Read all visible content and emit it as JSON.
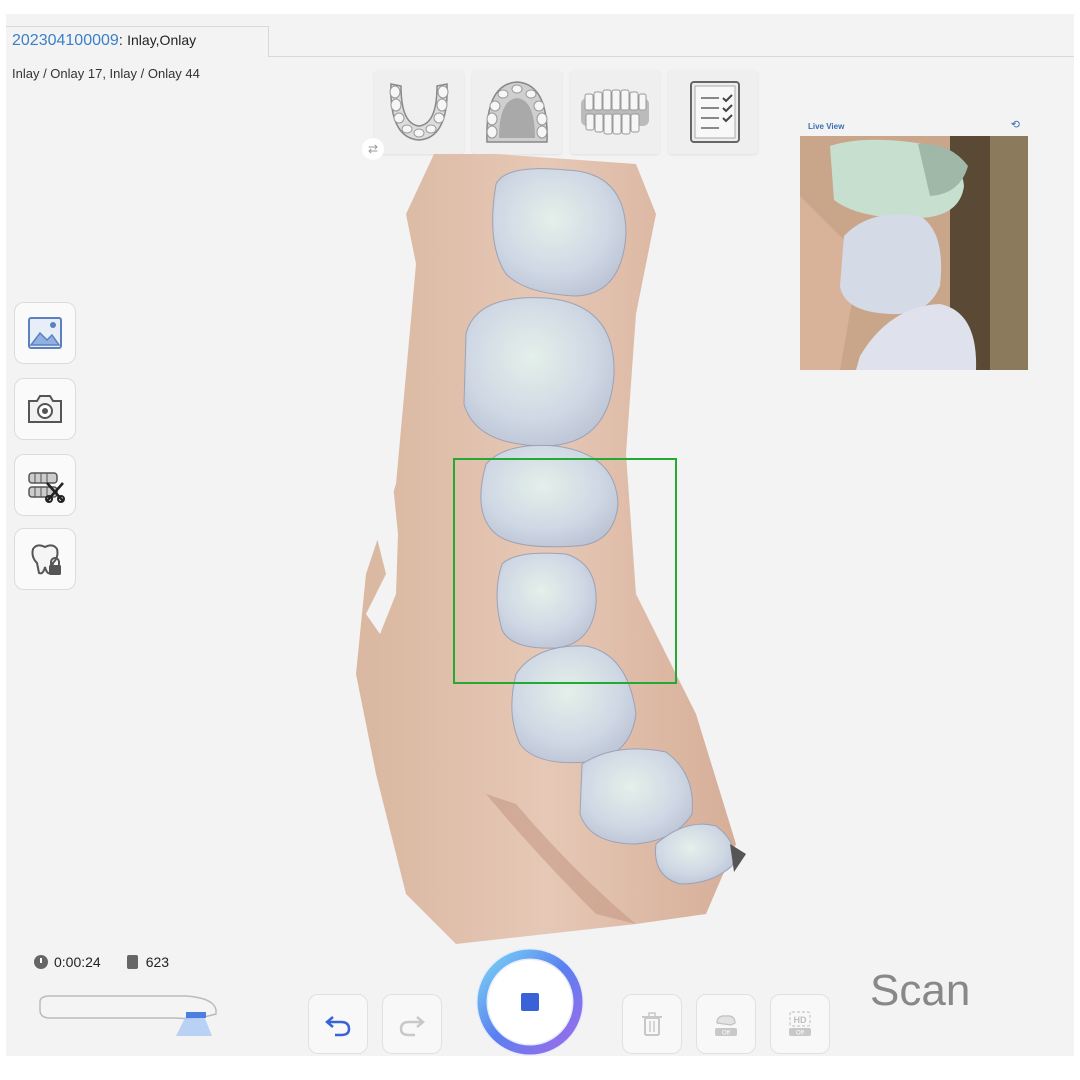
{
  "header": {
    "case_id": "202304100009",
    "separator": ": ",
    "case_type": "Inlay,Onlay",
    "teeth_info": "Inlay / Onlay 17, Inlay / Onlay 44"
  },
  "view_toolbar": [
    {
      "name": "upper-jaw-view",
      "icon": "upper-jaw-icon"
    },
    {
      "name": "lower-jaw-view",
      "icon": "lower-jaw-icon"
    },
    {
      "name": "bite-view",
      "icon": "bite-icon"
    },
    {
      "name": "checklist-view",
      "icon": "checklist-icon"
    }
  ],
  "side_tools": [
    {
      "name": "image-tool",
      "icon": "image-icon"
    },
    {
      "name": "capture-tool",
      "icon": "camera-icon"
    },
    {
      "name": "trim-tool",
      "icon": "jaw-cut-icon"
    },
    {
      "name": "lock-tool",
      "icon": "tooth-lock-icon"
    }
  ],
  "live_view": {
    "label": "Live View",
    "icon": "refresh-icon"
  },
  "status": {
    "elapsed": "0:00:24",
    "shot_count": "623"
  },
  "scan_controls": {
    "mode_label": "Scan",
    "hd_badge": "HD",
    "off_badge": "Off",
    "accent_color": "#3a62d8"
  }
}
